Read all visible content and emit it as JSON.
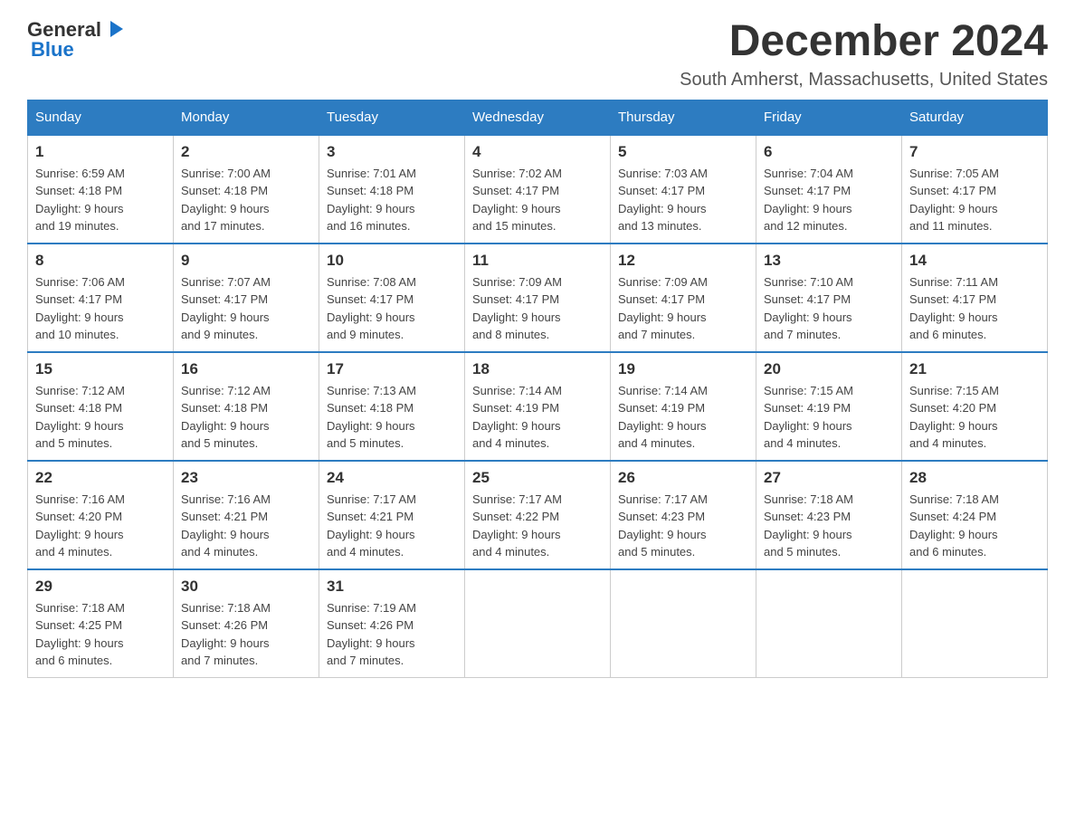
{
  "header": {
    "logo": {
      "general": "General",
      "blue": "Blue"
    },
    "month_title": "December 2024",
    "location": "South Amherst, Massachusetts, United States"
  },
  "days_of_week": [
    "Sunday",
    "Monday",
    "Tuesday",
    "Wednesday",
    "Thursday",
    "Friday",
    "Saturday"
  ],
  "weeks": [
    [
      {
        "day": "1",
        "sunrise": "6:59 AM",
        "sunset": "4:18 PM",
        "daylight": "9 hours and 19 minutes."
      },
      {
        "day": "2",
        "sunrise": "7:00 AM",
        "sunset": "4:18 PM",
        "daylight": "9 hours and 17 minutes."
      },
      {
        "day": "3",
        "sunrise": "7:01 AM",
        "sunset": "4:18 PM",
        "daylight": "9 hours and 16 minutes."
      },
      {
        "day": "4",
        "sunrise": "7:02 AM",
        "sunset": "4:17 PM",
        "daylight": "9 hours and 15 minutes."
      },
      {
        "day": "5",
        "sunrise": "7:03 AM",
        "sunset": "4:17 PM",
        "daylight": "9 hours and 13 minutes."
      },
      {
        "day": "6",
        "sunrise": "7:04 AM",
        "sunset": "4:17 PM",
        "daylight": "9 hours and 12 minutes."
      },
      {
        "day": "7",
        "sunrise": "7:05 AM",
        "sunset": "4:17 PM",
        "daylight": "9 hours and 11 minutes."
      }
    ],
    [
      {
        "day": "8",
        "sunrise": "7:06 AM",
        "sunset": "4:17 PM",
        "daylight": "9 hours and 10 minutes."
      },
      {
        "day": "9",
        "sunrise": "7:07 AM",
        "sunset": "4:17 PM",
        "daylight": "9 hours and 9 minutes."
      },
      {
        "day": "10",
        "sunrise": "7:08 AM",
        "sunset": "4:17 PM",
        "daylight": "9 hours and 9 minutes."
      },
      {
        "day": "11",
        "sunrise": "7:09 AM",
        "sunset": "4:17 PM",
        "daylight": "9 hours and 8 minutes."
      },
      {
        "day": "12",
        "sunrise": "7:09 AM",
        "sunset": "4:17 PM",
        "daylight": "9 hours and 7 minutes."
      },
      {
        "day": "13",
        "sunrise": "7:10 AM",
        "sunset": "4:17 PM",
        "daylight": "9 hours and 7 minutes."
      },
      {
        "day": "14",
        "sunrise": "7:11 AM",
        "sunset": "4:17 PM",
        "daylight": "9 hours and 6 minutes."
      }
    ],
    [
      {
        "day": "15",
        "sunrise": "7:12 AM",
        "sunset": "4:18 PM",
        "daylight": "9 hours and 5 minutes."
      },
      {
        "day": "16",
        "sunrise": "7:12 AM",
        "sunset": "4:18 PM",
        "daylight": "9 hours and 5 minutes."
      },
      {
        "day": "17",
        "sunrise": "7:13 AM",
        "sunset": "4:18 PM",
        "daylight": "9 hours and 5 minutes."
      },
      {
        "day": "18",
        "sunrise": "7:14 AM",
        "sunset": "4:19 PM",
        "daylight": "9 hours and 4 minutes."
      },
      {
        "day": "19",
        "sunrise": "7:14 AM",
        "sunset": "4:19 PM",
        "daylight": "9 hours and 4 minutes."
      },
      {
        "day": "20",
        "sunrise": "7:15 AM",
        "sunset": "4:19 PM",
        "daylight": "9 hours and 4 minutes."
      },
      {
        "day": "21",
        "sunrise": "7:15 AM",
        "sunset": "4:20 PM",
        "daylight": "9 hours and 4 minutes."
      }
    ],
    [
      {
        "day": "22",
        "sunrise": "7:16 AM",
        "sunset": "4:20 PM",
        "daylight": "9 hours and 4 minutes."
      },
      {
        "day": "23",
        "sunrise": "7:16 AM",
        "sunset": "4:21 PM",
        "daylight": "9 hours and 4 minutes."
      },
      {
        "day": "24",
        "sunrise": "7:17 AM",
        "sunset": "4:21 PM",
        "daylight": "9 hours and 4 minutes."
      },
      {
        "day": "25",
        "sunrise": "7:17 AM",
        "sunset": "4:22 PM",
        "daylight": "9 hours and 4 minutes."
      },
      {
        "day": "26",
        "sunrise": "7:17 AM",
        "sunset": "4:23 PM",
        "daylight": "9 hours and 5 minutes."
      },
      {
        "day": "27",
        "sunrise": "7:18 AM",
        "sunset": "4:23 PM",
        "daylight": "9 hours and 5 minutes."
      },
      {
        "day": "28",
        "sunrise": "7:18 AM",
        "sunset": "4:24 PM",
        "daylight": "9 hours and 6 minutes."
      }
    ],
    [
      {
        "day": "29",
        "sunrise": "7:18 AM",
        "sunset": "4:25 PM",
        "daylight": "9 hours and 6 minutes."
      },
      {
        "day": "30",
        "sunrise": "7:18 AM",
        "sunset": "4:26 PM",
        "daylight": "9 hours and 7 minutes."
      },
      {
        "day": "31",
        "sunrise": "7:19 AM",
        "sunset": "4:26 PM",
        "daylight": "9 hours and 7 minutes."
      },
      null,
      null,
      null,
      null
    ]
  ],
  "labels": {
    "sunrise": "Sunrise:",
    "sunset": "Sunset:",
    "daylight": "Daylight:"
  }
}
